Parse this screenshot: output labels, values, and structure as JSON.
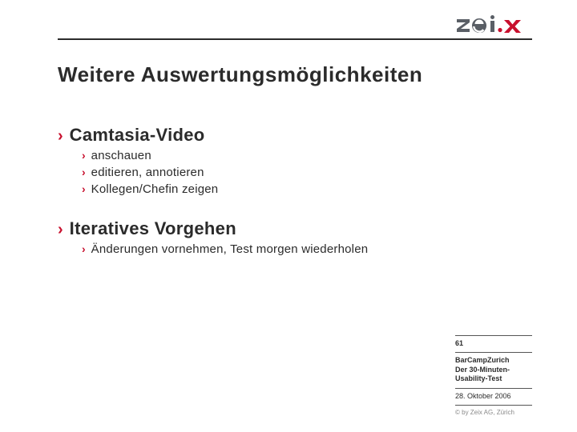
{
  "brand": {
    "name": "zeix",
    "accent": "#c8102e",
    "ink": "#2b2b2b"
  },
  "title": "Weitere Auswertungsmöglichkeiten",
  "sections": [
    {
      "heading": "Camtasia-Video",
      "items": [
        "anschauen",
        "editieren, annotieren",
        "Kollegen/Chefin zeigen"
      ]
    },
    {
      "heading": "Iteratives Vorgehen",
      "items": [
        "Änderungen vornehmen, Test morgen wiederholen"
      ]
    }
  ],
  "footer": {
    "page": "61",
    "event_line1": "BarCampZurich",
    "event_line2": "Der 30-Minuten-",
    "event_line3": "Usability-Test",
    "date": "28. Oktober 2006",
    "copyright": "© by Zeix AG, Zürich"
  }
}
